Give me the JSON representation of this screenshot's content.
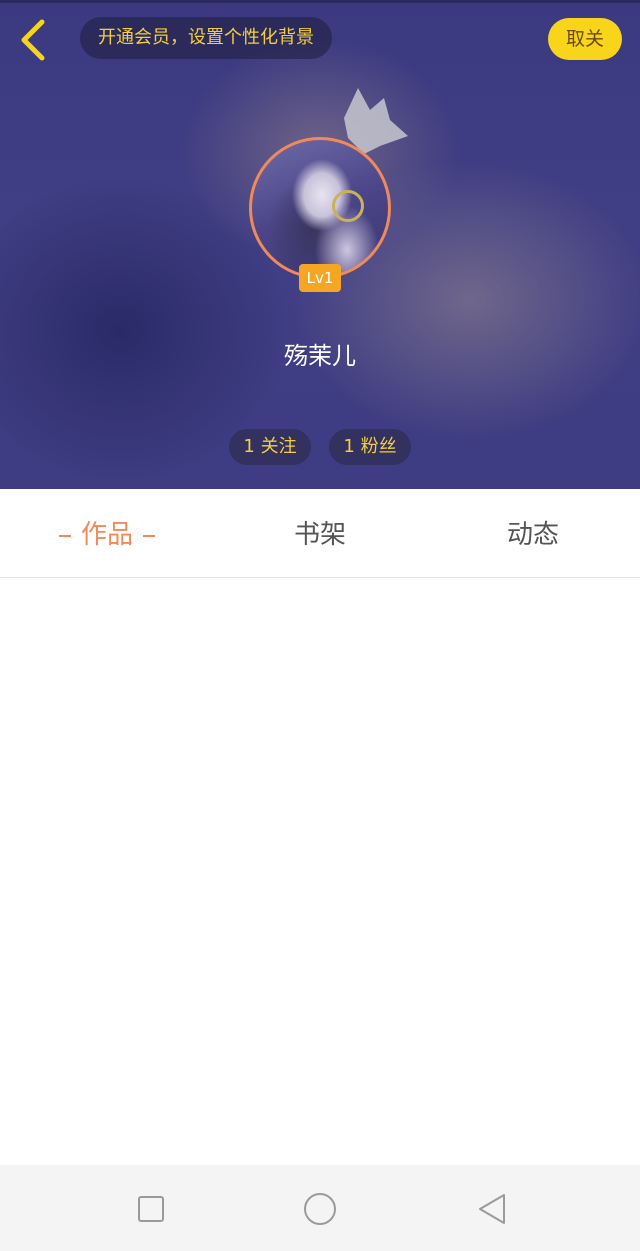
{
  "header": {
    "vip_banner": "开通会员，设置个性化背景",
    "unfollow_label": "取关",
    "level_badge": "Lv1",
    "username": "殇茉儿",
    "stats": {
      "following": "1 关注",
      "fans": "1 粉丝"
    }
  },
  "tabs": [
    {
      "label": "作品",
      "active": true
    },
    {
      "label": "书架",
      "active": false
    },
    {
      "label": "动态",
      "active": false
    }
  ],
  "icons": {
    "back": "chevron-left-icon",
    "crown": "crown-icon",
    "nav_recent": "square-icon",
    "nav_home": "circle-icon",
    "nav_back": "triangle-back-icon"
  },
  "colors": {
    "accent_yellow": "#f8d51b",
    "accent_orange": "#f08a5a",
    "header_bg": "#3e3c82"
  }
}
